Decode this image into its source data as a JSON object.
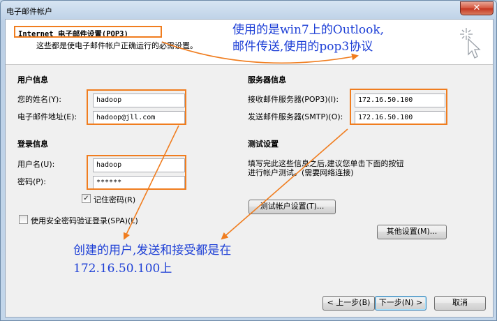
{
  "window": {
    "title": "电子邮件帐户",
    "close_glyph": "✕"
  },
  "header": {
    "title": "Internet 电子邮件设置(POP3)",
    "subtitle": "这些都是使电子邮件帐户正确运行的必需设置。",
    "icon": "cursor-sparkle-icon"
  },
  "user_info": {
    "heading": "用户信息",
    "name_label": "您的姓名(Y):",
    "name_value": "hadoop",
    "email_label": "电子邮件地址(E):",
    "email_value": "hadoop@jll.com"
  },
  "server_info": {
    "heading": "服务器信息",
    "incoming_label": "接收邮件服务器(POP3)(I):",
    "incoming_value": "172.16.50.100",
    "outgoing_label": "发送邮件服务器(SMTP)(O):",
    "outgoing_value": "172.16.50.100"
  },
  "login_info": {
    "heading": "登录信息",
    "username_label": "用户名(U):",
    "username_value": "hadoop",
    "password_label": "密码(P):",
    "password_value": "******",
    "remember_label": "记住密码(R)",
    "remember_checked": true,
    "remember_mark": "✓",
    "spa_label": "使用安全密码验证登录(SPA)(L)",
    "spa_checked": false
  },
  "test": {
    "heading": "测试设置",
    "description_line1": "填写完此这些信息之后,建议您单击下面的按钮",
    "description_line2": "进行帐户测试。(需要网络连接)",
    "test_button": "测试帐户设置(T)..."
  },
  "more_settings_button": "其他设置(M)...",
  "footer": {
    "back_button": "< 上一步(B)",
    "next_button": "下一步(N) >",
    "cancel_button": "取消"
  },
  "annotations": {
    "top_line1": "使用的是win7上的Outlook,",
    "top_line2": "邮件传送,使用的pop3协议",
    "bottom_line1": "创建的用户,发送和接受都是在",
    "bottom_line2": "172.16.50.100上"
  },
  "colors": {
    "annotation_text": "#1d3fd6",
    "highlight": "#f07d1f"
  }
}
